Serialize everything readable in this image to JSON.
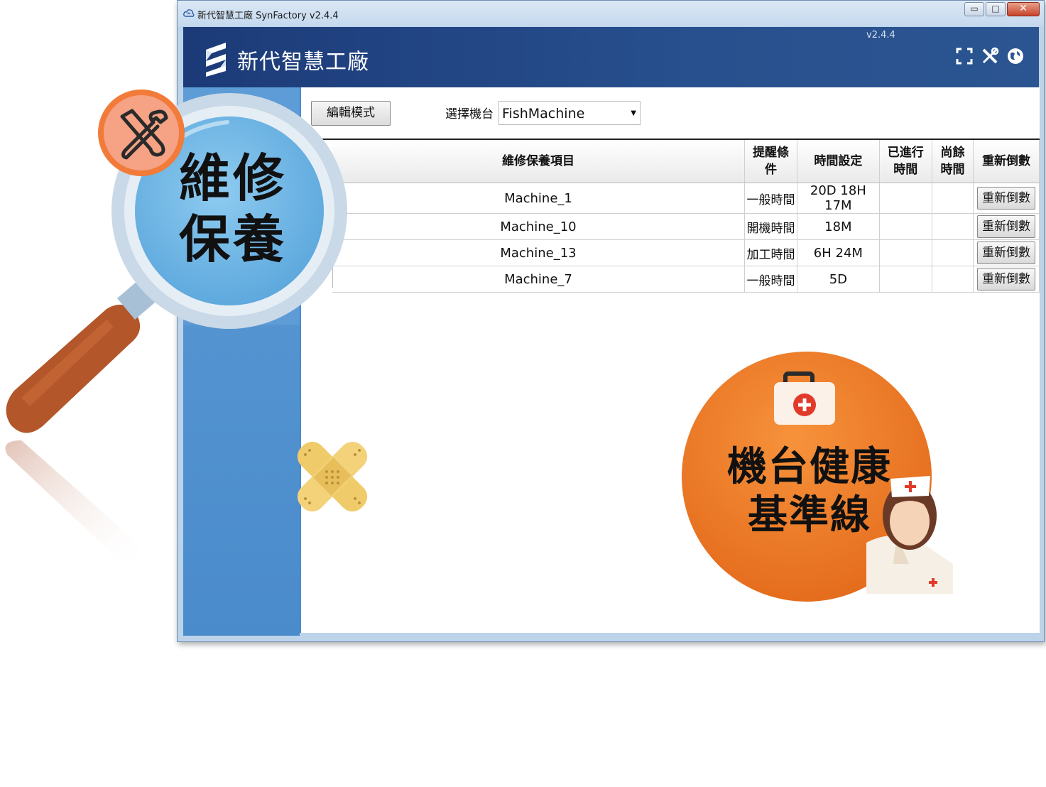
{
  "window": {
    "title": "新代智慧工廠 SynFactory v2.4.4"
  },
  "window_buttons": {
    "minimize": "▭",
    "maximize": "□",
    "close": "✕"
  },
  "header": {
    "brand": "新代智慧工廠",
    "version": "v2.4.4",
    "icons": [
      "fullscreen-icon",
      "tools-icon",
      "globe-icon"
    ]
  },
  "toolbar": {
    "edit_label": "編輯模式",
    "machine_label": "選擇機台",
    "machine_value": "FishMachine"
  },
  "table": {
    "headers": {
      "item": "維修保養項目",
      "condition_1": "提醒條",
      "condition_2": "件",
      "time_setting": "時間設定",
      "elapsed_1": "已進行",
      "elapsed_2": "時間",
      "remaining_1": "尚餘",
      "remaining_2": "時間",
      "reset": "重新倒數"
    },
    "rows": [
      {
        "item": "Machine_1",
        "condition": "一般時間",
        "time": "20D 18H 17M",
        "elapsed": "",
        "remaining": "",
        "reset": "重新倒數"
      },
      {
        "item": "Machine_10",
        "condition": "開機時間",
        "time": "18M",
        "elapsed": "",
        "remaining": "",
        "reset": "重新倒數"
      },
      {
        "item": "Machine_13",
        "condition": "加工時間",
        "time": "6H 24M",
        "elapsed": "",
        "remaining": "",
        "reset": "重新倒數"
      },
      {
        "item": "Machine_7",
        "condition": "一般時間",
        "time": "5D",
        "elapsed": "",
        "remaining": "",
        "reset": "重新倒數"
      }
    ]
  },
  "overlay": {
    "magnifier_line1": "維修",
    "magnifier_line2": "保養",
    "badge_line1": "機台健康",
    "badge_line2": "基準線"
  },
  "colors": {
    "header": "#1c3a78",
    "sidebar": "#4a8bcc",
    "badge_orange": "#ef7a22",
    "lens_blue": "#6eb6e6"
  }
}
